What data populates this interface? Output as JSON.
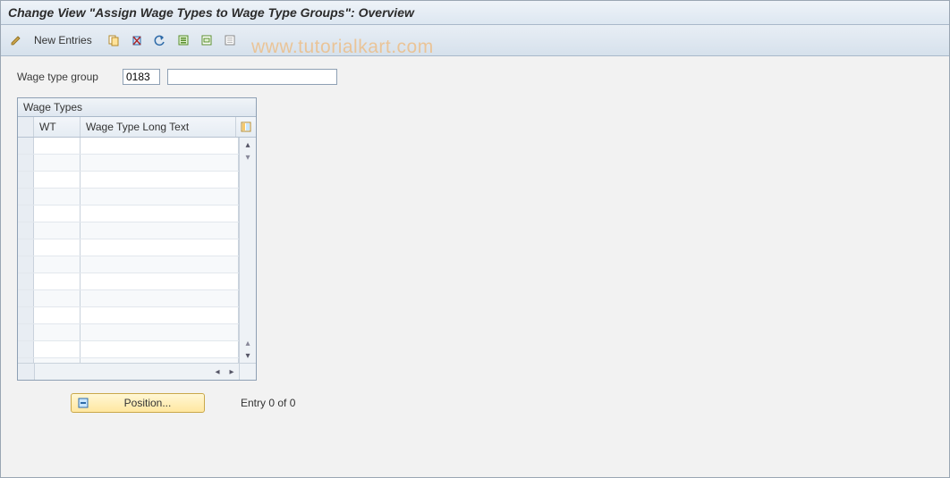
{
  "title": "Change View \"Assign Wage Types to Wage Type Groups\": Overview",
  "toolbar": {
    "new_entries_label": "New Entries"
  },
  "fields": {
    "wage_type_group_label": "Wage type group",
    "wage_type_group_code": "0183",
    "wage_type_group_desc": ""
  },
  "table": {
    "title": "Wage Types",
    "col_wt": "WT",
    "col_long": "Wage Type Long Text",
    "rows": [
      {
        "wt": "",
        "long": ""
      },
      {
        "wt": "",
        "long": ""
      },
      {
        "wt": "",
        "long": ""
      },
      {
        "wt": "",
        "long": ""
      },
      {
        "wt": "",
        "long": ""
      },
      {
        "wt": "",
        "long": ""
      },
      {
        "wt": "",
        "long": ""
      },
      {
        "wt": "",
        "long": ""
      },
      {
        "wt": "",
        "long": ""
      },
      {
        "wt": "",
        "long": ""
      },
      {
        "wt": "",
        "long": ""
      },
      {
        "wt": "",
        "long": ""
      },
      {
        "wt": "",
        "long": ""
      },
      {
        "wt": "",
        "long": ""
      }
    ]
  },
  "footer": {
    "position_label": "Position...",
    "entry_text": "Entry 0 of 0"
  },
  "watermark": "www.tutorialkart.com"
}
